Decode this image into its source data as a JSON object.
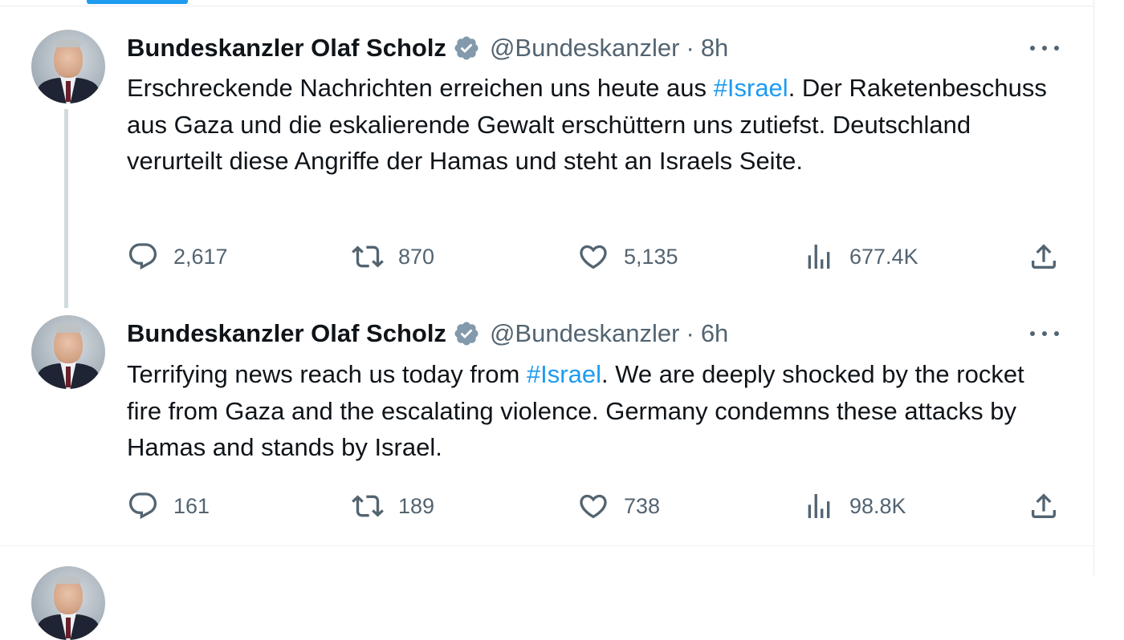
{
  "tweets": [
    {
      "author_name": "Bundeskanzler Olaf Scholz",
      "handle": "@Bundeskanzler",
      "separator": "·",
      "time": "8h",
      "text_before": "Erschreckende Nachrichten erreichen uns heute aus ",
      "hashtag": "#Israel",
      "text_after": ". Der Raketenbeschuss aus Gaza und die eskalierende Gewalt erschüttern uns zutiefst. Deutschland verurteilt diese Angriffe der Hamas und steht an Israels Seite.",
      "replies": "2,617",
      "retweets": "870",
      "likes": "5,135",
      "views": "677.4K"
    },
    {
      "author_name": "Bundeskanzler Olaf Scholz",
      "handle": "@Bundeskanzler",
      "separator": "·",
      "time": "6h",
      "text_before": "Terrifying news reach us today from ",
      "hashtag": "#Israel",
      "text_after": ". We are deeply shocked by the rocket fire from Gaza and the escalating violence. Germany condemns these attacks by Hamas and stands by Israel.",
      "replies": "161",
      "retweets": "189",
      "likes": "738",
      "views": "98.8K"
    }
  ],
  "icons": {
    "verified": "verified-badge-icon",
    "more": "more-icon",
    "reply": "reply-icon",
    "retweet": "retweet-icon",
    "like": "like-icon",
    "views": "views-icon",
    "share": "share-icon"
  },
  "colors": {
    "accent": "#1d9bf0",
    "secondary_text": "#536471",
    "verified_badge": "#829aab",
    "thread_line": "#cfd9de"
  }
}
